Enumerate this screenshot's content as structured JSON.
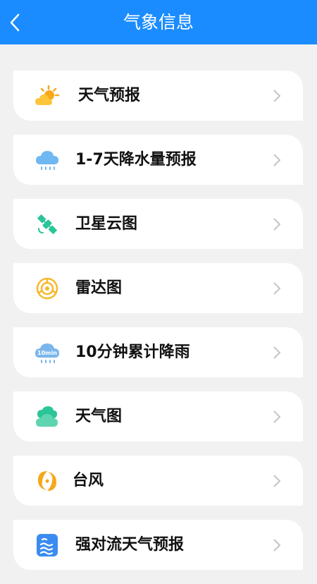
{
  "header": {
    "title": "气象信息",
    "back_icon": "chevron-left-icon"
  },
  "menu": [
    {
      "label": "天气预报",
      "icon": "sun-cloud-icon"
    },
    {
      "label": "1-7天降水量预报",
      "icon": "rain-cloud-icon"
    },
    {
      "label": "卫星云图",
      "icon": "satellite-icon"
    },
    {
      "label": "雷达图",
      "icon": "radar-icon"
    },
    {
      "label": "10分钟累计降雨",
      "icon": "rain-10min-icon",
      "icon_text": "10min"
    },
    {
      "label": "天气图",
      "icon": "cloud-icon"
    },
    {
      "label": "台风",
      "icon": "typhoon-icon"
    },
    {
      "label": "强对流天气预报",
      "icon": "convection-icon"
    }
  ],
  "colors": {
    "header": "#1a8cff",
    "background": "#f1f1f1",
    "chevron": "#c4c4c4"
  }
}
